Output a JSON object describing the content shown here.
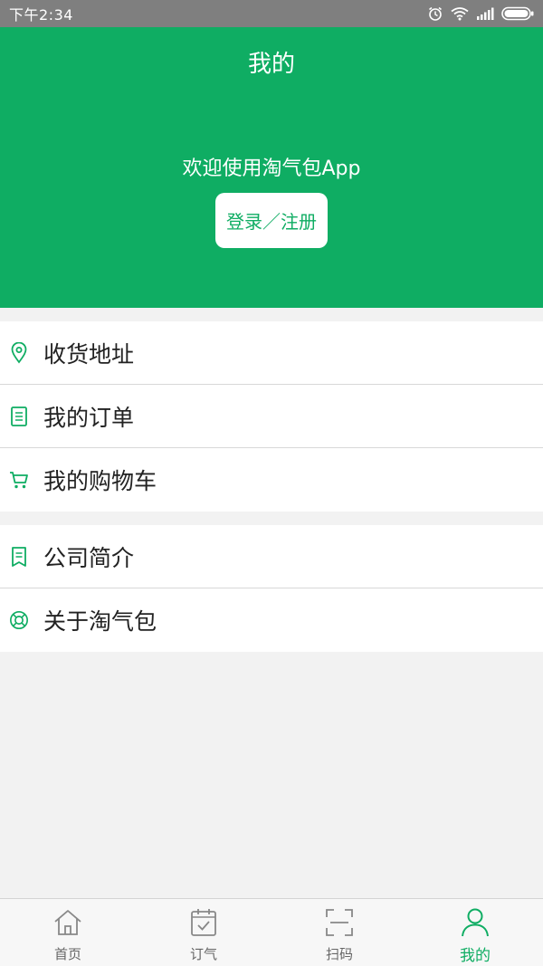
{
  "status_bar": {
    "time": "下午2:34"
  },
  "header": {
    "title": "我的",
    "welcome": "欢迎使用淘气包App",
    "login_label": "登录／注册"
  },
  "menu": {
    "group1": [
      {
        "label": "收货地址",
        "icon": "location-pin-icon"
      },
      {
        "label": "我的订单",
        "icon": "order-list-icon"
      },
      {
        "label": "我的购物车",
        "icon": "shopping-cart-icon"
      }
    ],
    "group2": [
      {
        "label": "公司简介",
        "icon": "bookmark-doc-icon"
      },
      {
        "label": "关于淘气包",
        "icon": "lifebuoy-icon"
      }
    ]
  },
  "tabs": [
    {
      "label": "首页",
      "icon": "home-icon",
      "active": false
    },
    {
      "label": "订气",
      "icon": "calendar-check-icon",
      "active": false
    },
    {
      "label": "扫码",
      "icon": "scan-icon",
      "active": false
    },
    {
      "label": "我的",
      "icon": "user-icon",
      "active": true
    }
  ],
  "colors": {
    "brand_green": "#0fad63",
    "status_bar": "#7f7f7f",
    "background": "#f2f2f2"
  }
}
